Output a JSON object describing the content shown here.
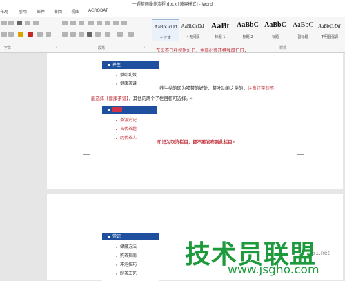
{
  "title": "一週茶网操作流程.docx [兼容模式] - Word",
  "menu": [
    "布局",
    "引用",
    "邮件",
    "审阅",
    "视图",
    "ACROBAT"
  ],
  "ribbon": {
    "groups": [
      "字体",
      "段落",
      "样式"
    ],
    "styles": [
      {
        "preview": "AaBbCcDd",
        "name": "↵ 正文"
      },
      {
        "preview": "AaBbCcDd",
        "name": "↵ 无间隔"
      },
      {
        "preview": "AaBt",
        "name": "标题 1"
      },
      {
        "preview": "AaBbC",
        "name": "标题 2"
      },
      {
        "preview": "AaBbC",
        "name": "标题"
      },
      {
        "preview": "AaBbC",
        "name": "副标题"
      },
      {
        "preview": "AaBbCcDd",
        "name": "不明显强调"
      }
    ]
  },
  "page1": {
    "top_clipped_text": "东头不已经按附址日，生部小要还押我风仁日，",
    "panel1": {
      "header": "养生",
      "items": [
        "茶叶功效",
        "健康茶谱"
      ]
    },
    "line1_black": "养生类的即为喝茶的好处、茶叶功能之类的，",
    "line1_red": "注意红茶的不",
    "line2_red": "能选择【健康茶谱】",
    "line2_black": "，其他的两个子栏目都可选择。↵",
    "panel2": {
      "items": [
        "茶源史记",
        "古代茶趣",
        "历代茶人"
      ]
    },
    "red_note": "印记为取消栏目，都不要发布到此栏目↵"
  },
  "page2": {
    "panel": {
      "header": "常识",
      "items": [
        "储藏方法",
        "购茶指南",
        "冲泡技巧",
        "制茶工艺"
      ]
    }
  },
  "watermark": {
    "text": "技术员联盟",
    "url": "www.jsgho.com",
    "corner": "51.net"
  }
}
